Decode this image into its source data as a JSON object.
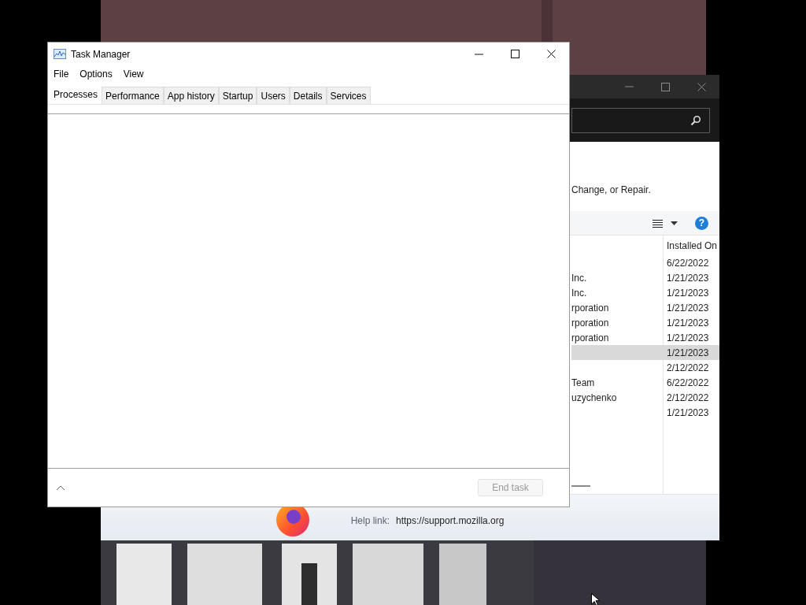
{
  "programs_window": {
    "instruction": "Change, or Repair.",
    "columns": [
      {
        "label": "Installed On"
      }
    ],
    "rows": [
      {
        "installed_on": "6/22/2022",
        "selected": false
      },
      {
        "column_1": "Inc.",
        "installed_on": "1/21/2023",
        "selected": false
      },
      {
        "column_1": "Inc.",
        "installed_on": "1/21/2023",
        "selected": false
      },
      {
        "column_1": "rporation",
        "installed_on": "1/21/2023",
        "selected": false
      },
      {
        "column_1": "rporation",
        "installed_on": "1/21/2023",
        "selected": false
      },
      {
        "column_1": "rporation",
        "installed_on": "1/21/2023",
        "selected": false
      },
      {
        "installed_on": "1/21/2023",
        "selected": true
      },
      {
        "installed_on": "2/12/2022",
        "selected": false
      },
      {
        "column_1": "Team",
        "installed_on": "6/22/2022",
        "selected": false
      },
      {
        "column_1": "uzychenko",
        "installed_on": "2/12/2022",
        "selected": false
      },
      {
        "installed_on": "1/21/2023",
        "selected": false
      }
    ],
    "help_button": "?",
    "details": {
      "help_link_label": "Help link:",
      "help_link": "https://support.mozilla.org"
    }
  },
  "task_manager": {
    "title": "Task Manager",
    "menu": [
      "File",
      "Options",
      "View"
    ],
    "tabs": [
      {
        "label": "Processes",
        "selected": true
      },
      {
        "label": "Performance",
        "selected": false
      },
      {
        "label": "App history",
        "selected": false
      },
      {
        "label": "Startup",
        "selected": false
      },
      {
        "label": "Users",
        "selected": false
      },
      {
        "label": "Details",
        "selected": false
      },
      {
        "label": "Services",
        "selected": false
      }
    ],
    "end_task": {
      "label": "End task",
      "disabled": true
    }
  }
}
